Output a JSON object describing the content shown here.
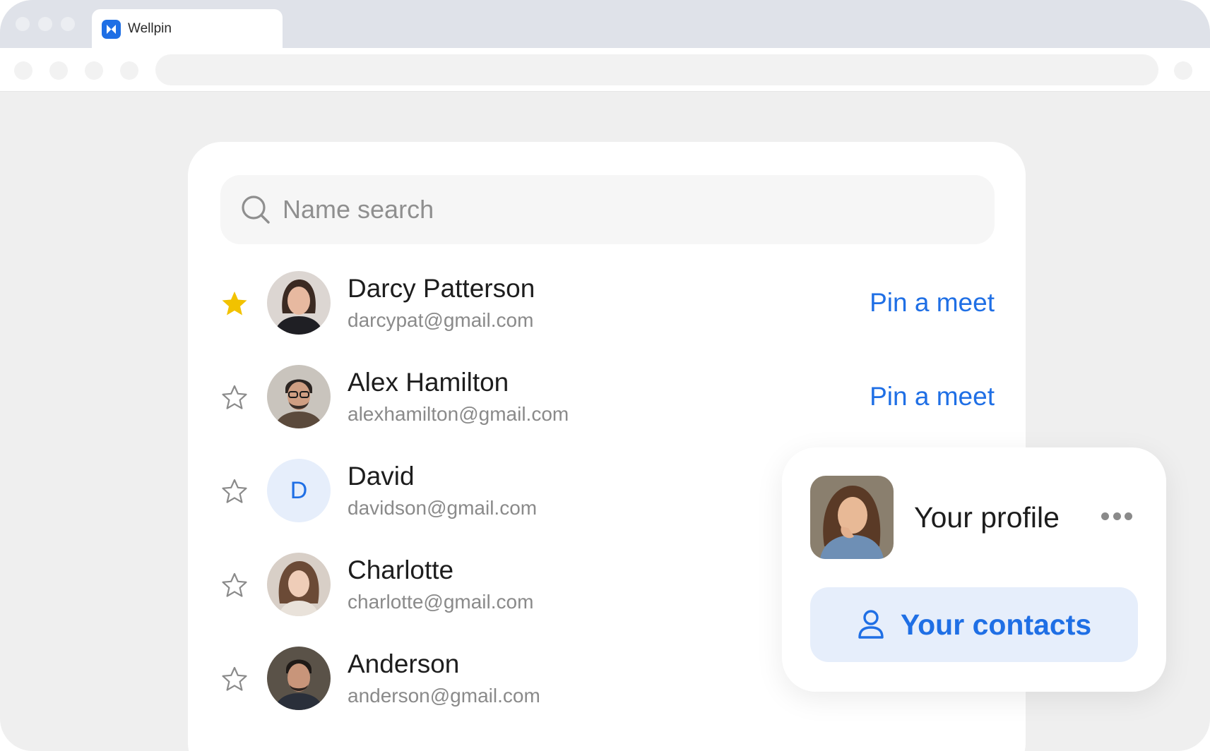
{
  "browser": {
    "tab_title": "Wellpin"
  },
  "search": {
    "placeholder": "Name search"
  },
  "contacts": [
    {
      "name": "Darcy Patterson",
      "email": "darcypat@gmail.com",
      "starred": true,
      "action": "Pin a meet"
    },
    {
      "name": "Alex Hamilton",
      "email": "alexhamilton@gmail.com",
      "starred": false,
      "action": "Pin a meet"
    },
    {
      "name": "David",
      "email": "davidson@gmail.com",
      "starred": false,
      "initial": "D"
    },
    {
      "name": "Charlotte",
      "email": "charlotte@gmail.com",
      "starred": false
    },
    {
      "name": "Anderson",
      "email": "anderson@gmail.com",
      "starred": false
    }
  ],
  "profile_popup": {
    "title": "Your profile",
    "button_label": "Your contacts"
  },
  "colors": {
    "accent": "#1f6fe5",
    "star_filled": "#f2c200",
    "accent_soft": "#e6eefb"
  }
}
